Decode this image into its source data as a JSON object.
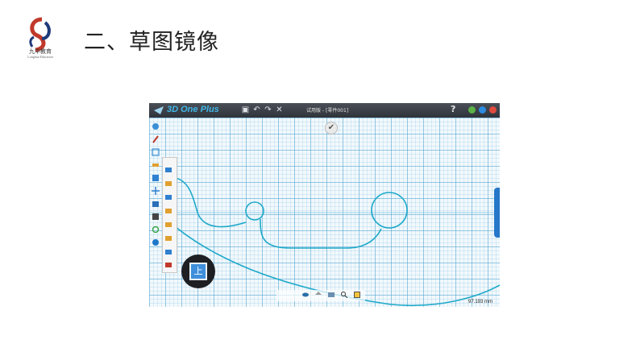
{
  "slide": {
    "title": "二、草图镜像",
    "logo_text": "九华教育",
    "logo_subtext": "Longhua Education"
  },
  "app": {
    "name": "3D One Plus",
    "document_title": "试用版 - [零件001]",
    "help_label": "?",
    "toolbar": [
      {
        "name": "save",
        "glyph": "💾"
      },
      {
        "name": "undo",
        "glyph": "↶"
      },
      {
        "name": "redo",
        "glyph": "↷"
      },
      {
        "name": "cut",
        "glyph": "✂"
      }
    ],
    "window_colors": {
      "minimize": "#5bb245",
      "maximize": "#2d8be0",
      "close": "#e04a3c"
    },
    "view_label": "上",
    "measure": "97.193 mm",
    "accent": "#1fa9c9"
  }
}
